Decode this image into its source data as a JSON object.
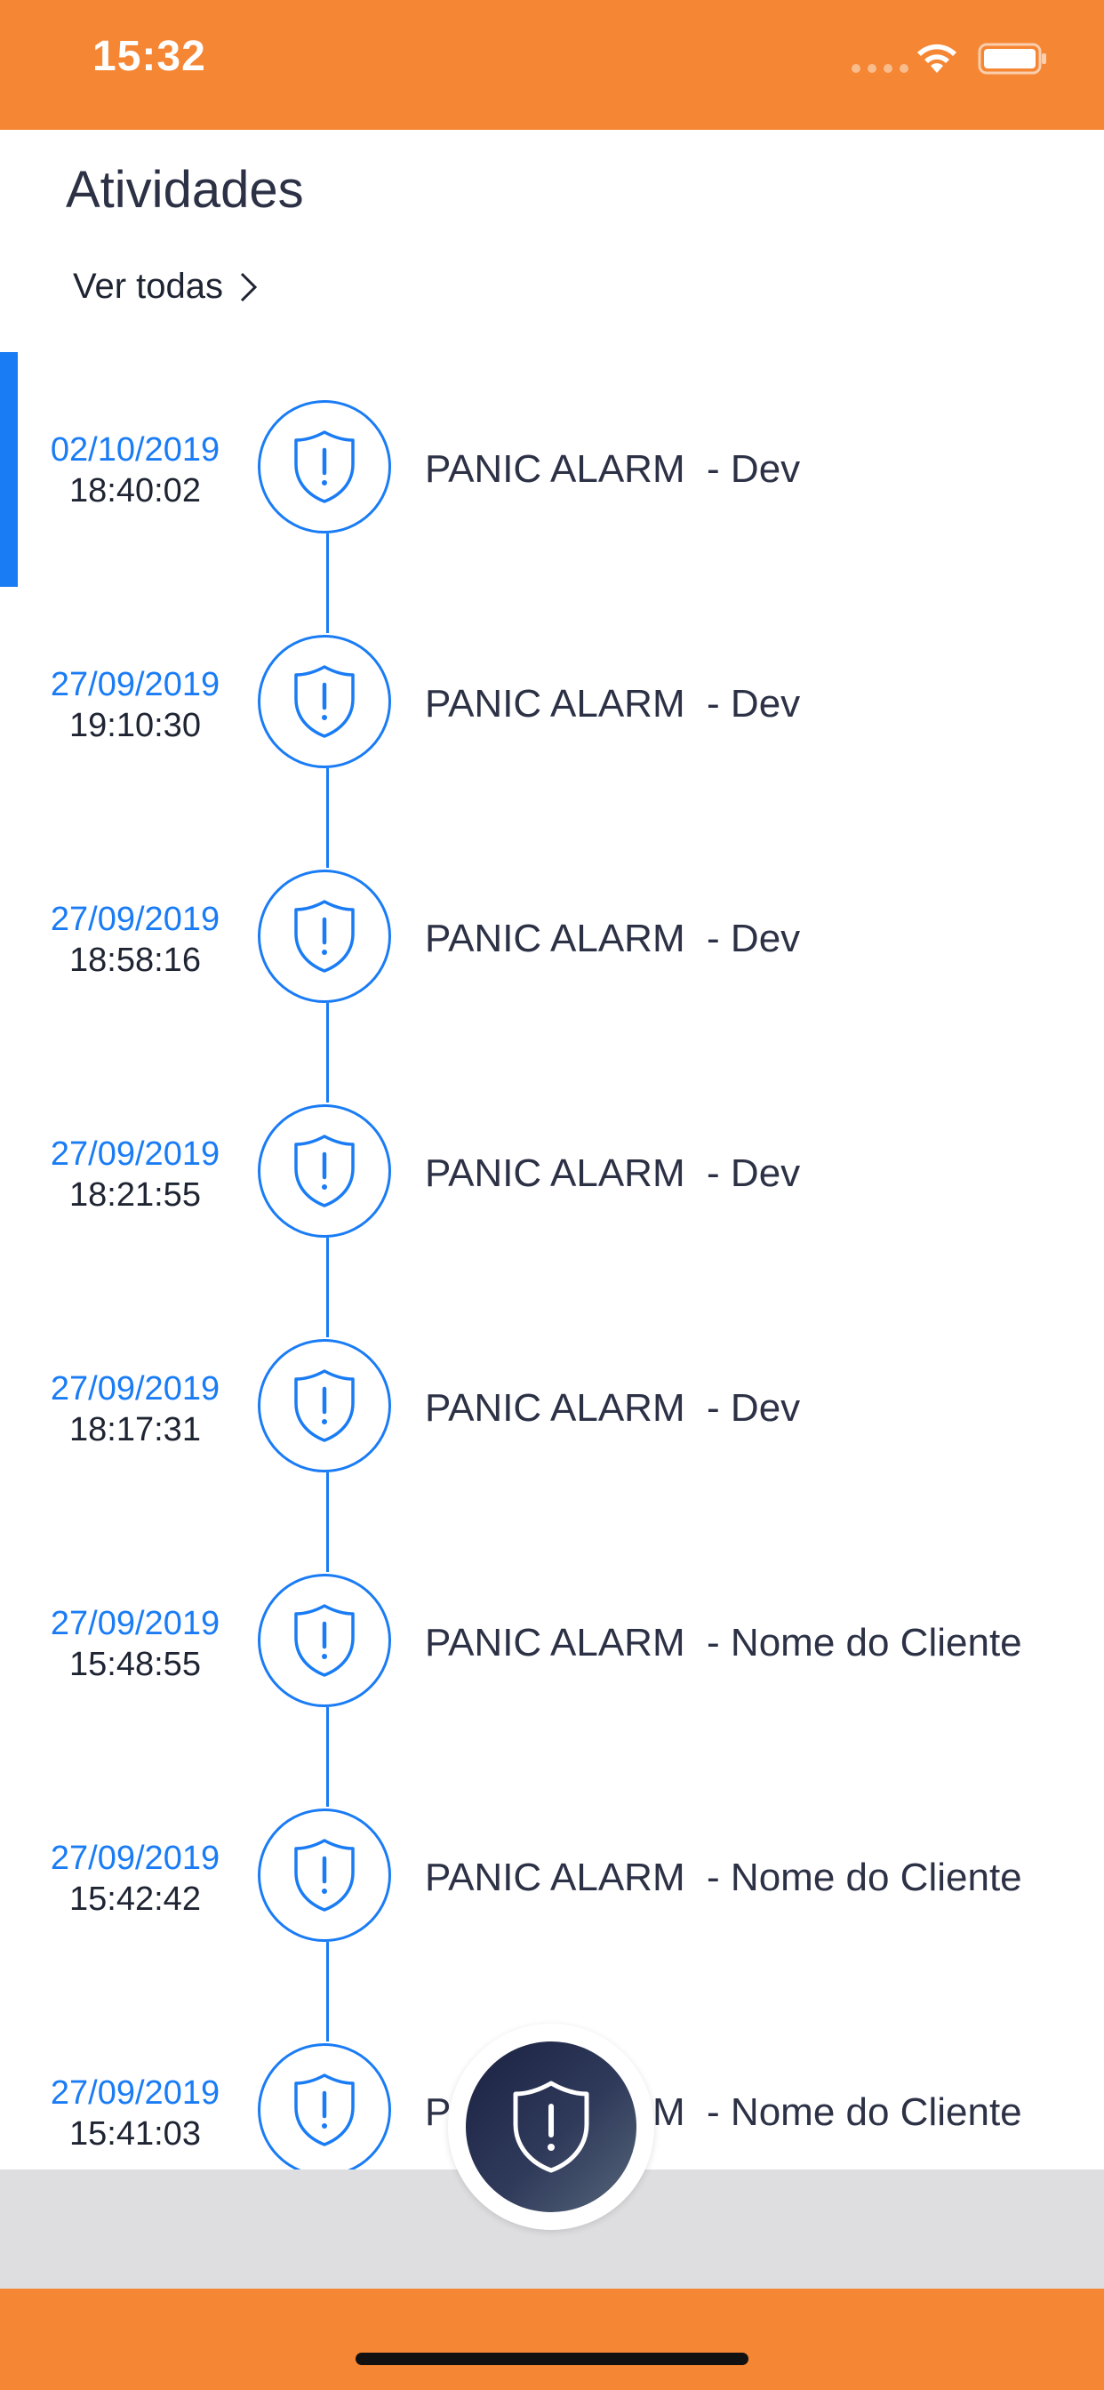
{
  "status_bar": {
    "time": "15:32",
    "background": "#f58634"
  },
  "header": {
    "title": "Atividades",
    "see_all_label": "Ver todas"
  },
  "colors": {
    "accent": "#1a7cf5",
    "brand": "#f58634",
    "text_dark": "#2c3145"
  },
  "activities": [
    {
      "date": "02/10/2019",
      "time": "18:40:02",
      "title": "PANIC ALARM  - Dev",
      "icon": "shield-alert-icon",
      "selected": true
    },
    {
      "date": "27/09/2019",
      "time": "19:10:30",
      "title": "PANIC ALARM  - Dev",
      "icon": "shield-alert-icon"
    },
    {
      "date": "27/09/2019",
      "time": "18:58:16",
      "title": "PANIC ALARM  - Dev",
      "icon": "shield-alert-icon"
    },
    {
      "date": "27/09/2019",
      "time": "18:21:55",
      "title": "PANIC ALARM  - Dev",
      "icon": "shield-alert-icon"
    },
    {
      "date": "27/09/2019",
      "time": "18:17:31",
      "title": "PANIC ALARM  - Dev",
      "icon": "shield-alert-icon"
    },
    {
      "date": "27/09/2019",
      "time": "15:48:55",
      "title": "PANIC ALARM  - Nome do Cliente",
      "icon": "shield-alert-icon"
    },
    {
      "date": "27/09/2019",
      "time": "15:42:42",
      "title": "PANIC ALARM  - Nome do Cliente",
      "icon": "shield-alert-icon"
    },
    {
      "date": "27/09/2019",
      "time": "15:41:03",
      "title": "PANIC ALARM  - Nome do Cliente",
      "icon": "shield-alert-icon"
    }
  ],
  "fab": {
    "icon": "shield-alert-icon"
  }
}
